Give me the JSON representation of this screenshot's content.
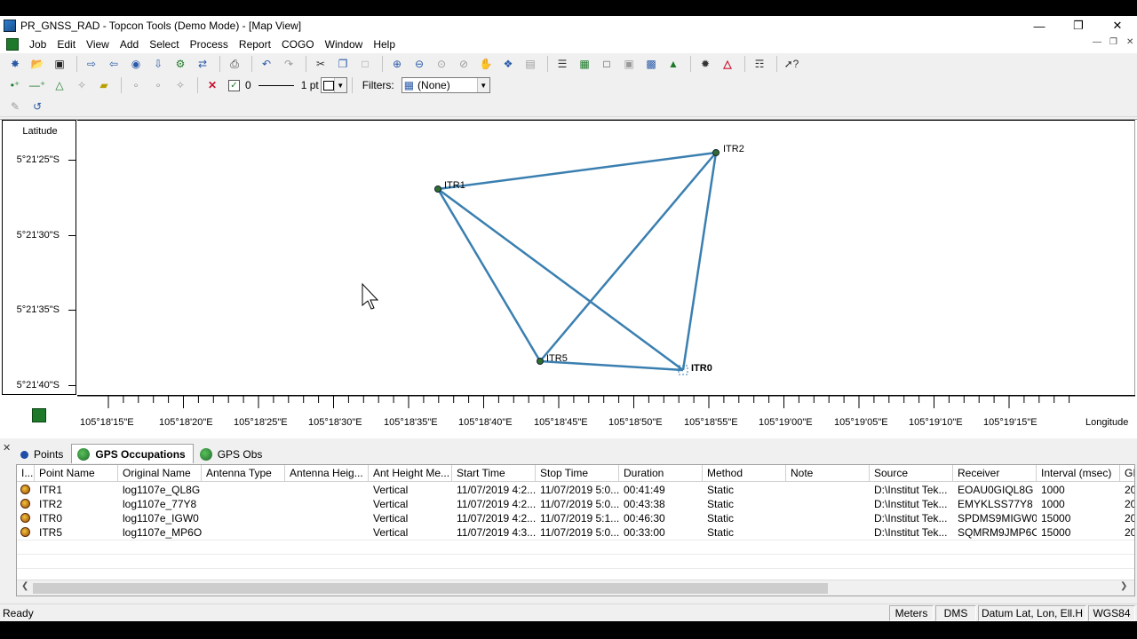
{
  "window": {
    "title": "PR_GNSS_RAD - Topcon Tools (Demo Mode) - [Map View]",
    "minimize": "—",
    "restore": "❐",
    "close": "✕"
  },
  "menu": [
    "Job",
    "Edit",
    "View",
    "Add",
    "Select",
    "Process",
    "Report",
    "COGO",
    "Window",
    "Help"
  ],
  "toolbar2": {
    "line_value": "0",
    "line_weight": "1 pt",
    "filters_label": "Filters:",
    "filters_value": "(None)"
  },
  "map": {
    "lat_header": "Latitude",
    "lat_ticks": [
      "5°21'25\"S",
      "5°21'30\"S",
      "5°21'35\"S",
      "5°21'40\"S"
    ],
    "lon_ticks": [
      "105°18'15\"E",
      "105°18'20\"E",
      "105°18'25\"E",
      "105°18'30\"E",
      "105°18'35\"E",
      "105°18'40\"E",
      "105°18'45\"E",
      "105°18'50\"E",
      "105°18'55\"E",
      "105°19'00\"E",
      "105°19'05\"E",
      "105°19'10\"E",
      "105°19'15\"E"
    ],
    "lon_header": "Longitude",
    "points": [
      {
        "name": "ITR1"
      },
      {
        "name": "ITR2"
      },
      {
        "name": "ITR5"
      },
      {
        "name": "ITR0"
      }
    ],
    "line_color": "#3a7fb0"
  },
  "tabs": [
    {
      "label": "Points",
      "active": false
    },
    {
      "label": "GPS Occupations",
      "active": true
    },
    {
      "label": "GPS Obs",
      "active": false
    }
  ],
  "grid": {
    "columns": [
      "I...",
      "Point Name",
      "Original Name",
      "Antenna Type",
      "Antenna Heig...",
      "Ant Height Me...",
      "Start Time",
      "Stop Time",
      "Duration",
      "Method",
      "Note",
      "Source",
      "Receiver",
      "Interval (msec)",
      "GI"
    ],
    "rows": [
      [
        "ITR1",
        "log1107e_QL8G",
        "",
        "",
        "Vertical",
        "11/07/2019 4:2...",
        "11/07/2019 5:0...",
        "00:41:49",
        "Static",
        "",
        "D:\\Institut Tek...",
        "EOAU0GIQL8G",
        "1000",
        "20"
      ],
      [
        "ITR2",
        "log1107e_77Y8",
        "",
        "",
        "Vertical",
        "11/07/2019 4:2...",
        "11/07/2019 5:0...",
        "00:43:38",
        "Static",
        "",
        "D:\\Institut Tek...",
        "EMYKLSS77Y8",
        "1000",
        "20"
      ],
      [
        "ITR0",
        "log1107e_IGW0",
        "",
        "",
        "Vertical",
        "11/07/2019 4:2...",
        "11/07/2019 5:1...",
        "00:46:30",
        "Static",
        "",
        "D:\\Institut Tek...",
        "SPDMS9MIGW0",
        "15000",
        "20"
      ],
      [
        "ITR5",
        "log1107e_MP6O",
        "",
        "",
        "Vertical",
        "11/07/2019 4:3...",
        "11/07/2019 5:0...",
        "00:33:00",
        "Static",
        "",
        "D:\\Institut Tek...",
        "SQMRM9JMP6O",
        "15000",
        "20"
      ]
    ]
  },
  "status": {
    "ready": "Ready",
    "units": "Meters",
    "angle": "DMS",
    "datum": "Datum Lat, Lon, Ell.H",
    "system": "WGS84"
  }
}
